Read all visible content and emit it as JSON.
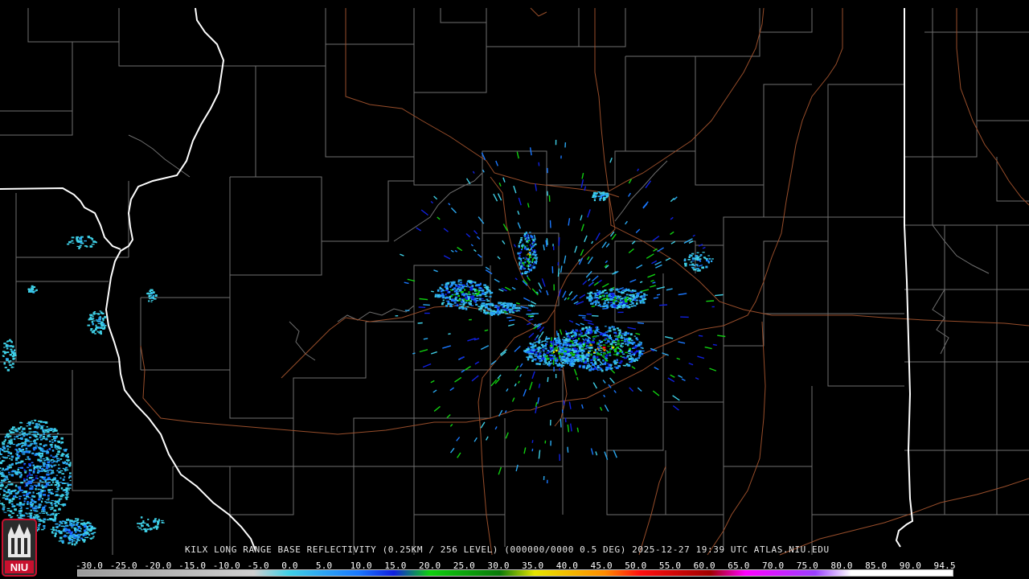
{
  "caption": "KILX LONG RANGE BASE REFLECTIVITY (0.25KM / 256 LEVEL) (000000/0000 0.5 DEG) 2025-12-27 19:39 UTC  ATLAS.NIU.EDU",
  "logo_text": "NIU",
  "scale": {
    "labels": [
      "-30.0",
      "-25.0",
      "-20.0",
      "-15.0",
      "-10.0",
      "-5.0",
      "0.0",
      "5.0",
      "10.0",
      "15.0",
      "20.0",
      "25.0",
      "30.0",
      "35.0",
      "40.0",
      "45.0",
      "50.0",
      "55.0",
      "60.0",
      "65.0",
      "70.0",
      "75.0",
      "80.0",
      "85.0",
      "90.0",
      "94.5"
    ],
    "stops": [
      {
        "value": -30,
        "color": "#9a9a9a"
      },
      {
        "value": -5,
        "color": "#cfcfcf"
      },
      {
        "value": 0,
        "color": "#3fd0e6"
      },
      {
        "value": 10,
        "color": "#1a78ff"
      },
      {
        "value": 15,
        "color": "#1020e0"
      },
      {
        "value": 20,
        "color": "#10d010"
      },
      {
        "value": 30,
        "color": "#0a7a0a"
      },
      {
        "value": 35,
        "color": "#e6e600"
      },
      {
        "value": 45,
        "color": "#ff8c00"
      },
      {
        "value": 50,
        "color": "#ff1010"
      },
      {
        "value": 60,
        "color": "#a00000"
      },
      {
        "value": 65,
        "color": "#ff00ff"
      },
      {
        "value": 75,
        "color": "#9a40ff"
      },
      {
        "value": 80,
        "color": "#ffffff"
      },
      {
        "value": 94.5,
        "color": "#ffffff"
      }
    ]
  },
  "colors": {
    "background": "#000000",
    "county_lines": "#6f6f6f",
    "state_lines": "#ffffff",
    "highways": "#a0522d",
    "logo_red": "#c8102e"
  }
}
